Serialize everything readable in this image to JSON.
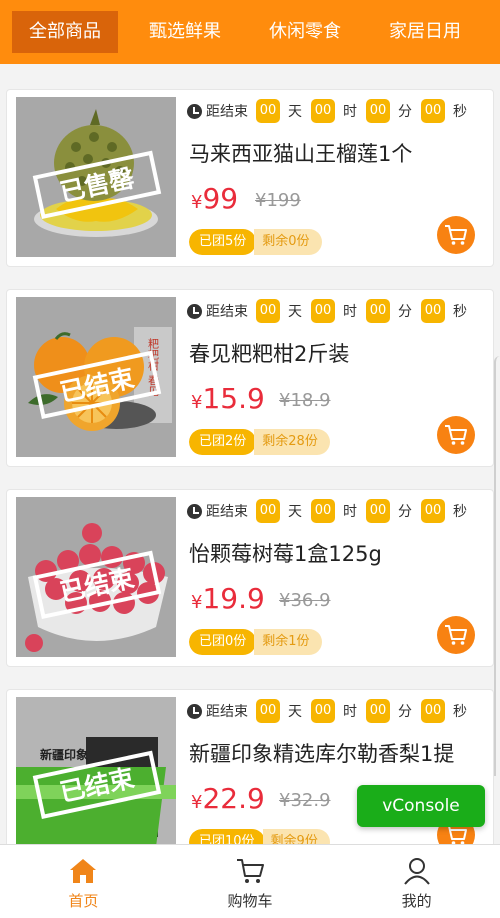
{
  "tabs": [
    {
      "label": "全部商品",
      "active": true
    },
    {
      "label": "甄选鲜果",
      "active": false
    },
    {
      "label": "休闲零食",
      "active": false
    },
    {
      "label": "家居日用",
      "active": false
    }
  ],
  "countdown_label": "距结束",
  "countdown": {
    "days": "00",
    "hours": "00",
    "minutes": "00",
    "seconds": "00"
  },
  "units": {
    "day": "天",
    "hour": "时",
    "minute": "分",
    "second": "秒"
  },
  "currency": "¥",
  "products": [
    {
      "name": "马来西亚猫山王榴莲1个",
      "price": "99",
      "old_price": "¥199",
      "grouped": "已团5份",
      "remaining": "剩余0份",
      "stamp": "已售罄"
    },
    {
      "name": "春见粑粑柑2斤装",
      "price": "15.9",
      "old_price": "¥18.9",
      "grouped": "已团2份",
      "remaining": "剩余28份",
      "stamp": "已结束"
    },
    {
      "name": "怡颗莓树莓1盒125g",
      "price": "19.9",
      "old_price": "¥36.9",
      "grouped": "已团0份",
      "remaining": "剩余1份",
      "stamp": "已结束"
    },
    {
      "name": "新疆印象精选库尔勒香梨1提",
      "price": "22.9",
      "old_price": "¥32.9",
      "grouped": "已团10份",
      "remaining": "剩余9份",
      "stamp": "已结束"
    }
  ],
  "image_text": {
    "orange_box": "粑粑柑 春见",
    "pear_box": "新疆印象"
  },
  "vconsole_label": "vConsole",
  "bottom_nav": [
    {
      "label": "首页",
      "active": true
    },
    {
      "label": "购物车",
      "active": false
    },
    {
      "label": "我的",
      "active": false
    }
  ],
  "colors": {
    "brand_orange": "#ff8c0d",
    "active_tab": "#d9640a",
    "price_red": "#e92c3b",
    "timer_yellow": "#f7b500",
    "vconsole_green": "#1aad19"
  }
}
